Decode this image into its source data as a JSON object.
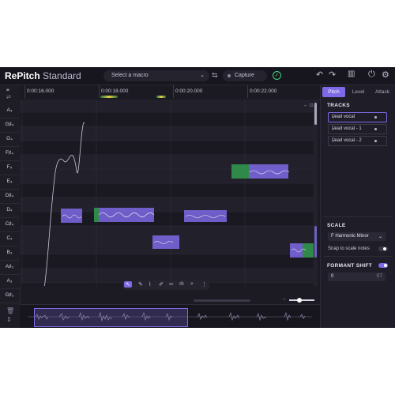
{
  "app": {
    "logo_bold": "RePitch",
    "logo_light": " Standard",
    "macro_placeholder": "Select a macro",
    "capture_label": "Capture"
  },
  "ruler": {
    "ticks": [
      "0:00:16.000",
      "0:00:18.000",
      "0:00:20.000",
      "0:00:22.000"
    ]
  },
  "notes": [
    "A4",
    "G#4",
    "G4",
    "F#4",
    "F4",
    "E4",
    "D#4",
    "D4",
    "C#4",
    "C4",
    "B3",
    "A#3",
    "A3",
    "G#3"
  ],
  "note_labels": {
    "A4": "A₄",
    "G#4": "G♯₄",
    "G4": "G₄",
    "F#4": "F♯₄",
    "F4": "F₄",
    "E4": "E₄",
    "D#4": "D♯₄",
    "D4": "D₄",
    "C#4": "C♯₄",
    "C4": "C₄",
    "B3": "B₃",
    "A#3": "A♯₃",
    "A3": "A₃",
    "G#3": "G♯₃"
  },
  "panel": {
    "tabs": [
      "Pitch",
      "Level",
      "Attack"
    ],
    "active_tab": "Pitch",
    "tracks_heading": "TRACKS",
    "tracks": [
      "Lead vocal",
      "Lead vocal - 1",
      "Lead vocal - 2"
    ],
    "scale_heading": "SCALE",
    "scale_value": "F Harmonic Minor",
    "snap_label": "Snap to scale notes",
    "formant_heading": "FORMANT SHIFT",
    "formant_value": "0",
    "formant_unit": "ST"
  },
  "colors": {
    "accent": "#7e6ae6",
    "green": "#43d17e",
    "background": "#1c1b24"
  }
}
